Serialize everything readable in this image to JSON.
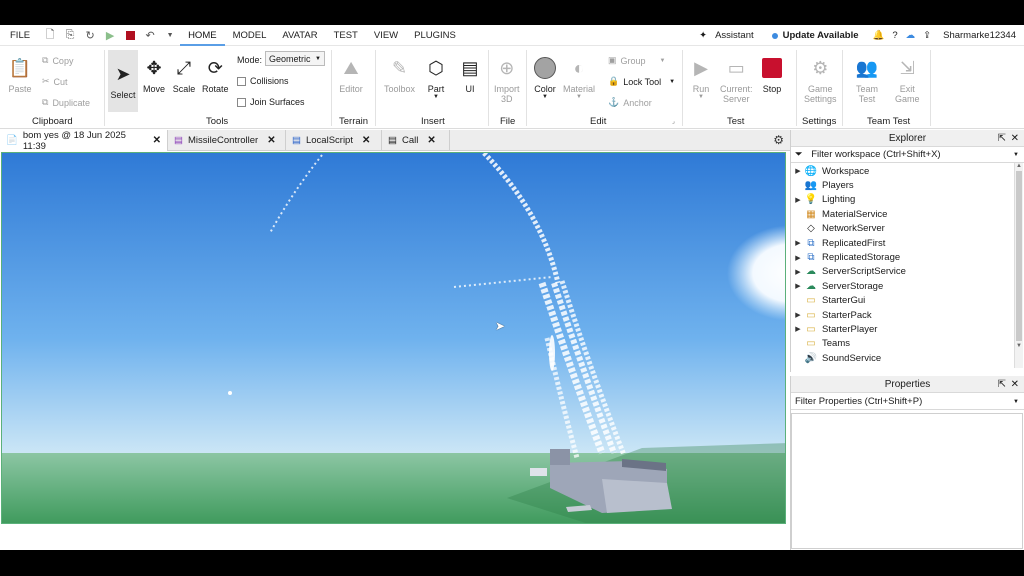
{
  "menubar": {
    "file_label": "FILE",
    "tabs": [
      "HOME",
      "MODEL",
      "AVATAR",
      "TEST",
      "VIEW",
      "PLUGINS"
    ],
    "assistant_label": "Assistant",
    "update_label": "Update Available",
    "username": "Sharmarke12344"
  },
  "ribbon": {
    "clipboard": {
      "paste": "Paste",
      "copy": "Copy",
      "cut": "Cut",
      "duplicate": "Duplicate",
      "group_label": "Clipboard"
    },
    "tools": {
      "select": "Select",
      "move": "Move",
      "scale": "Scale",
      "rotate": "Rotate",
      "mode_label": "Mode:",
      "mode_value": "Geometric",
      "collisions": "Collisions",
      "join_surfaces": "Join Surfaces",
      "group_label": "Tools"
    },
    "terrain": {
      "editor": "Editor",
      "group_label": "Terrain"
    },
    "insert": {
      "toolbox": "Toolbox",
      "part": "Part",
      "ui": "UI",
      "group_label": "Insert"
    },
    "file": {
      "import3d_line1": "Import",
      "import3d_line2": "3D",
      "group_label": "File"
    },
    "edit": {
      "color": "Color",
      "material": "Material",
      "group": "Group",
      "lock_tool": "Lock Tool",
      "anchor": "Anchor",
      "group_label": "Edit"
    },
    "test": {
      "run": "Run",
      "current_line1": "Current:",
      "current_line2": "Server",
      "stop": "Stop",
      "group_label": "Test"
    },
    "settings": {
      "game_line1": "Game",
      "game_line2": "Settings",
      "group_label": "Settings"
    },
    "team_test": {
      "team_line1": "Team",
      "team_line2": "Test",
      "exit_line1": "Exit",
      "exit_line2": "Game",
      "group_label": "Team Test"
    }
  },
  "doc_tabs": [
    {
      "label": "bom yes @ 18 Jun 2025 11:39"
    },
    {
      "label": "MissileController"
    },
    {
      "label": "LocalScript"
    },
    {
      "label": "Call"
    }
  ],
  "explorer": {
    "title": "Explorer",
    "filter_placeholder": "Filter workspace (Ctrl+Shift+X)",
    "items": [
      {
        "label": "Workspace",
        "icon": "globe-icon",
        "expandable": true
      },
      {
        "label": "Players",
        "icon": "players-icon",
        "expandable": false
      },
      {
        "label": "Lighting",
        "icon": "lightbulb-icon",
        "expandable": true
      },
      {
        "label": "MaterialService",
        "icon": "material-service-icon",
        "expandable": false
      },
      {
        "label": "NetworkServer",
        "icon": "network-icon",
        "expandable": false
      },
      {
        "label": "ReplicatedFirst",
        "icon": "replicated-first-icon",
        "expandable": true
      },
      {
        "label": "ReplicatedStorage",
        "icon": "replicated-storage-icon",
        "expandable": true
      },
      {
        "label": "ServerScriptService",
        "icon": "server-script-icon",
        "expandable": true
      },
      {
        "label": "ServerStorage",
        "icon": "server-storage-icon",
        "expandable": true
      },
      {
        "label": "StarterGui",
        "icon": "starter-gui-icon",
        "expandable": false
      },
      {
        "label": "StarterPack",
        "icon": "starter-pack-icon",
        "expandable": true
      },
      {
        "label": "StarterPlayer",
        "icon": "starter-player-icon",
        "expandable": true
      },
      {
        "label": "Teams",
        "icon": "teams-icon",
        "expandable": false
      },
      {
        "label": "SoundService",
        "icon": "sound-icon",
        "expandable": false
      }
    ]
  },
  "properties": {
    "title": "Properties",
    "filter_placeholder": "Filter Properties (Ctrl+Shift+P)"
  },
  "colors": {
    "accent": "#5a9ee6",
    "stop_red": "#c8102e",
    "sky_top": "#2f7ad6",
    "ground": "#3e9a5c"
  }
}
